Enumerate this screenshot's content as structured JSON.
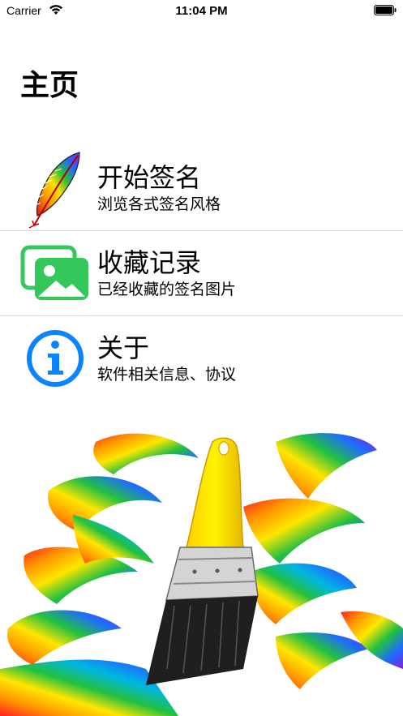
{
  "status": {
    "carrier": "Carrier",
    "time": "11:04 PM"
  },
  "page": {
    "title": "主页"
  },
  "menu": [
    {
      "title": "开始签名",
      "subtitle": "浏览各式签名风格",
      "icon": "rainbow-feather-icon"
    },
    {
      "title": "收藏记录",
      "subtitle": "已经收藏的签名图片",
      "icon": "photo-gallery-icon"
    },
    {
      "title": "关于",
      "subtitle": "软件相关信息、协议",
      "icon": "info-circle-icon"
    }
  ],
  "colors": {
    "gallery_green": "#34c759",
    "info_blue": "#0a84ff",
    "separator": "#dcdcdc"
  }
}
